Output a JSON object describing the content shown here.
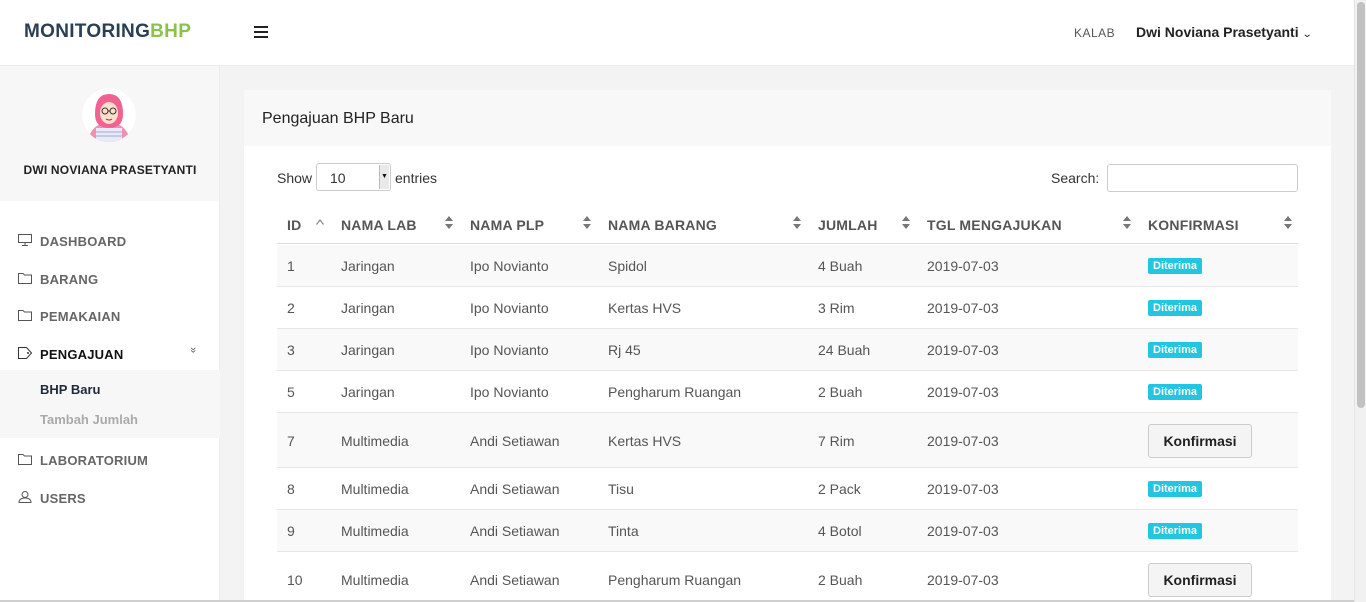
{
  "brand": {
    "part1": "MONITORING",
    "part2": "BHP"
  },
  "header": {
    "role": "KALAB",
    "user_name": "Dwi Noviana Prasetyanti",
    "chevron": "⌄"
  },
  "sidebar": {
    "profile_name": "DWI NOVIANA PRASETYANTI",
    "items": [
      {
        "label": "DASHBOARD",
        "icon": "monitor-icon"
      },
      {
        "label": "BARANG",
        "icon": "folder-icon"
      },
      {
        "label": "PEMAKAIAN",
        "icon": "folder-icon"
      },
      {
        "label": "PENGAJUAN",
        "icon": "tag-icon",
        "caret": "»"
      },
      {
        "label": "LABORATORIUM",
        "icon": "folder-icon"
      },
      {
        "label": "USERS",
        "icon": "user-icon"
      }
    ],
    "submenu": [
      {
        "label": "BHP Baru",
        "active": true
      },
      {
        "label": "Tambah Jumlah",
        "active": false
      }
    ]
  },
  "panel": {
    "title": "Pengajuan BHP Baru",
    "show_label": "Show",
    "entries_value": "10",
    "entries_label": "entries",
    "search_label": "Search:",
    "search_value": ""
  },
  "table": {
    "columns": [
      "ID",
      "NAMA LAB",
      "NAMA PLP",
      "NAMA BARANG",
      "JUMLAH",
      "TGL MENGAJUKAN",
      "KONFIRMASI"
    ],
    "rows": [
      {
        "id": "1",
        "lab": "Jaringan",
        "plp": "Ipo Novianto",
        "barang": "Spidol",
        "jumlah": "4 Buah",
        "tgl": "2019-07-03",
        "konfirmasi": "Diterima",
        "type": "badge"
      },
      {
        "id": "2",
        "lab": "Jaringan",
        "plp": "Ipo Novianto",
        "barang": "Kertas HVS",
        "jumlah": "3 Rim",
        "tgl": "2019-07-03",
        "konfirmasi": "Diterima",
        "type": "badge"
      },
      {
        "id": "3",
        "lab": "Jaringan",
        "plp": "Ipo Novianto",
        "barang": "Rj 45",
        "jumlah": "24 Buah",
        "tgl": "2019-07-03",
        "konfirmasi": "Diterima",
        "type": "badge"
      },
      {
        "id": "5",
        "lab": "Jaringan",
        "plp": "Ipo Novianto",
        "barang": "Pengharum Ruangan",
        "jumlah": "2 Buah",
        "tgl": "2019-07-03",
        "konfirmasi": "Diterima",
        "type": "badge"
      },
      {
        "id": "7",
        "lab": "Multimedia",
        "plp": "Andi Setiawan",
        "barang": "Kertas HVS",
        "jumlah": "7 Rim",
        "tgl": "2019-07-03",
        "konfirmasi": "Konfirmasi",
        "type": "button"
      },
      {
        "id": "8",
        "lab": "Multimedia",
        "plp": "Andi Setiawan",
        "barang": "Tisu",
        "jumlah": "2 Pack",
        "tgl": "2019-07-03",
        "konfirmasi": "Diterima",
        "type": "badge"
      },
      {
        "id": "9",
        "lab": "Multimedia",
        "plp": "Andi Setiawan",
        "barang": "Tinta",
        "jumlah": "4 Botol",
        "tgl": "2019-07-03",
        "konfirmasi": "Diterima",
        "type": "badge"
      },
      {
        "id": "10",
        "lab": "Multimedia",
        "plp": "Andi Setiawan",
        "barang": "Pengharum Ruangan",
        "jumlah": "2 Buah",
        "tgl": "2019-07-03",
        "konfirmasi": "Konfirmasi",
        "type": "button"
      }
    ]
  },
  "colors": {
    "brand_dark": "#2a3f54",
    "brand_green": "#8bc34a",
    "badge": "#23c6e0"
  }
}
